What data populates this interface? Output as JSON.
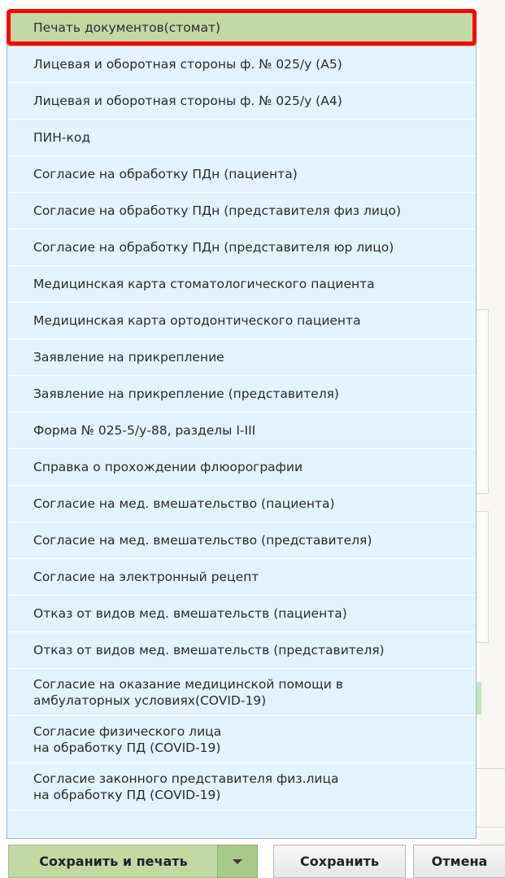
{
  "menu": {
    "items": [
      {
        "label": "Печать документов(стомат)"
      },
      {
        "label": "Лицевая и оборотная стороны ф. № 025/у (А5)"
      },
      {
        "label": "Лицевая и оборотная стороны ф. № 025/у (А4)"
      },
      {
        "label": "ПИН-код"
      },
      {
        "label": "Согласие на обработку ПДн (пациента)"
      },
      {
        "label": "Согласие на обработку ПДн (представителя физ лицо)"
      },
      {
        "label": "Согласие на обработку ПДн (представителя юр лицо)"
      },
      {
        "label": "Медицинская карта стоматологического пациента"
      },
      {
        "label": "Медицинская карта ортодонтического пациента"
      },
      {
        "label": "Заявление на прикрепление"
      },
      {
        "label": "Заявление на прикрепление (представителя)"
      },
      {
        "label": "Форма № 025-5/у-88, разделы I-III"
      },
      {
        "label": "Справка о прохождении флюорографии"
      },
      {
        "label": "Согласие на мед. вмешательство (пациента)"
      },
      {
        "label": "Согласие на мед. вмешательство (представителя)"
      },
      {
        "label": "Согласие на электронный рецепт"
      },
      {
        "label": "Отказ от видов мед. вмешательств (пациента)"
      },
      {
        "label": "Отказ от видов мед. вмешательств (представителя)"
      },
      {
        "label": "Согласие на оказание медицинской помощи в\nамбулаторных условиях(COVID-19)"
      },
      {
        "label": "Согласие физического лица\nна обработку ПД (COVID-19)"
      },
      {
        "label": "Согласие законного представителя физ.лица\nна обработку ПД (COVID-19)"
      }
    ]
  },
  "buttons": {
    "save_and_print": "Сохранить и печать",
    "save": "Сохранить",
    "cancel": "Отмена"
  },
  "icons": {
    "dropdown": "chevron-down-icon"
  },
  "colors": {
    "menu_background": "#e3f3fd",
    "selected_item": "#c2d9a4",
    "highlight_frame": "#ff0000",
    "primary_button": "#c2d9a4"
  }
}
